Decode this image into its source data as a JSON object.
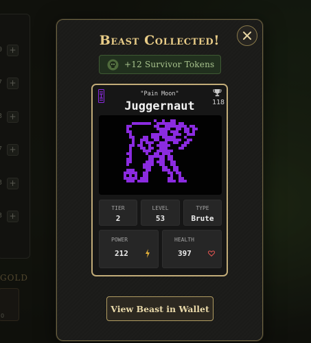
{
  "background": {
    "panel_rows": [
      {
        "value": "0"
      },
      {
        "value": "7"
      },
      {
        "value": "3"
      },
      {
        "value": "7"
      },
      {
        "value": "3"
      },
      {
        "value": "3"
      }
    ],
    "gold_label": "GOLD",
    "thumb_caption": "0"
  },
  "modal": {
    "title": "Beast Collected!",
    "tokens_label": "+12 Survivor Tokens",
    "card": {
      "nickname": "\"Pain Moon\"",
      "name": "Juggernaut",
      "score": "118",
      "stats": {
        "tier_label": "TIER",
        "tier_value": "2",
        "level_label": "LEVEL",
        "level_value": "53",
        "type_label": "TYPE",
        "type_value": "Brute",
        "power_label": "POWER",
        "power_value": "212",
        "health_label": "HEALTH",
        "health_value": "397"
      }
    },
    "wallet_button": "View Beast in Wallet"
  },
  "colors": {
    "gold": "#e8cc87",
    "beast_purple": "#8b2be0",
    "token_green": "#a9c58e",
    "power_yellow": "#e8b43a",
    "health_red": "#d9534f"
  },
  "icons": {
    "close": "close-icon",
    "token": "skull-token-icon",
    "rank": "rank-glyph-icon",
    "trophy": "trophy-icon",
    "power": "lightning-icon",
    "health": "heart-icon"
  }
}
